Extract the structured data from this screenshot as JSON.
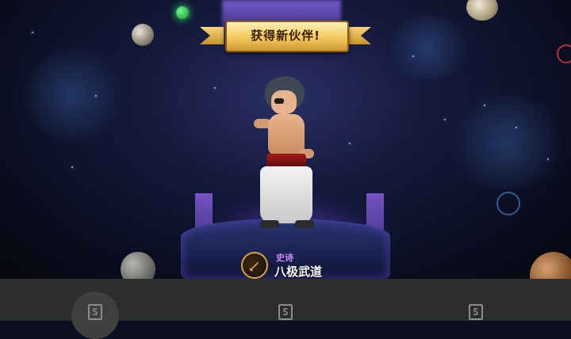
{
  "banner": {
    "title": "获得新伙伴!"
  },
  "companion": {
    "rarity": "史诗",
    "name": "八极武道",
    "class_icon": "sword-icon"
  },
  "bottom_bar": {
    "items": [
      {
        "icon": "share-icon",
        "glyph": "S"
      },
      {
        "icon": "share-icon",
        "glyph": "S"
      },
      {
        "icon": "share-icon",
        "glyph": "S"
      }
    ]
  },
  "colors": {
    "rarity": "#c889ff",
    "banner_gold": "#f4c95e",
    "pedestal_glow": "#8250ff"
  }
}
